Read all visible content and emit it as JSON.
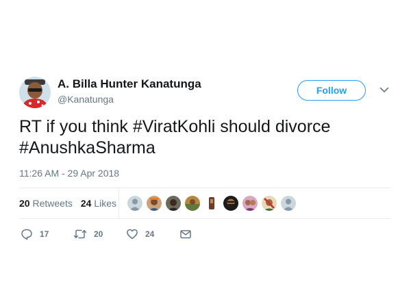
{
  "user": {
    "display_name": "A. Billa Hunter Kanatunga",
    "handle": "@Kanatunga",
    "avatar_icon": "profile-avatar-icon"
  },
  "follow_button": {
    "label": "Follow",
    "color": "#1da1f2"
  },
  "tweet": {
    "text_lines": [
      "RT if you think #ViratKohli should divorce",
      "#AnushkaSharma"
    ],
    "timestamp": "11:26 AM - 29 Apr 2018"
  },
  "stats": {
    "retweets_count": "20",
    "retweets_label": "Retweets",
    "likes_count": "24",
    "likes_label": "Likes"
  },
  "liker_avatars": [
    "default",
    "photo",
    "photo",
    "photo",
    "photo",
    "photo",
    "photo",
    "photo",
    "default"
  ],
  "actions": {
    "reply_count": "17",
    "retweet_count": "20",
    "like_count": "24",
    "icons": [
      "reply-icon",
      "retweet-icon",
      "like-icon",
      "direct-message-icon"
    ]
  },
  "colors": {
    "text": "#14171a",
    "secondary": "#657786",
    "border": "#e6ecf0",
    "accent": "#1da1f2"
  }
}
